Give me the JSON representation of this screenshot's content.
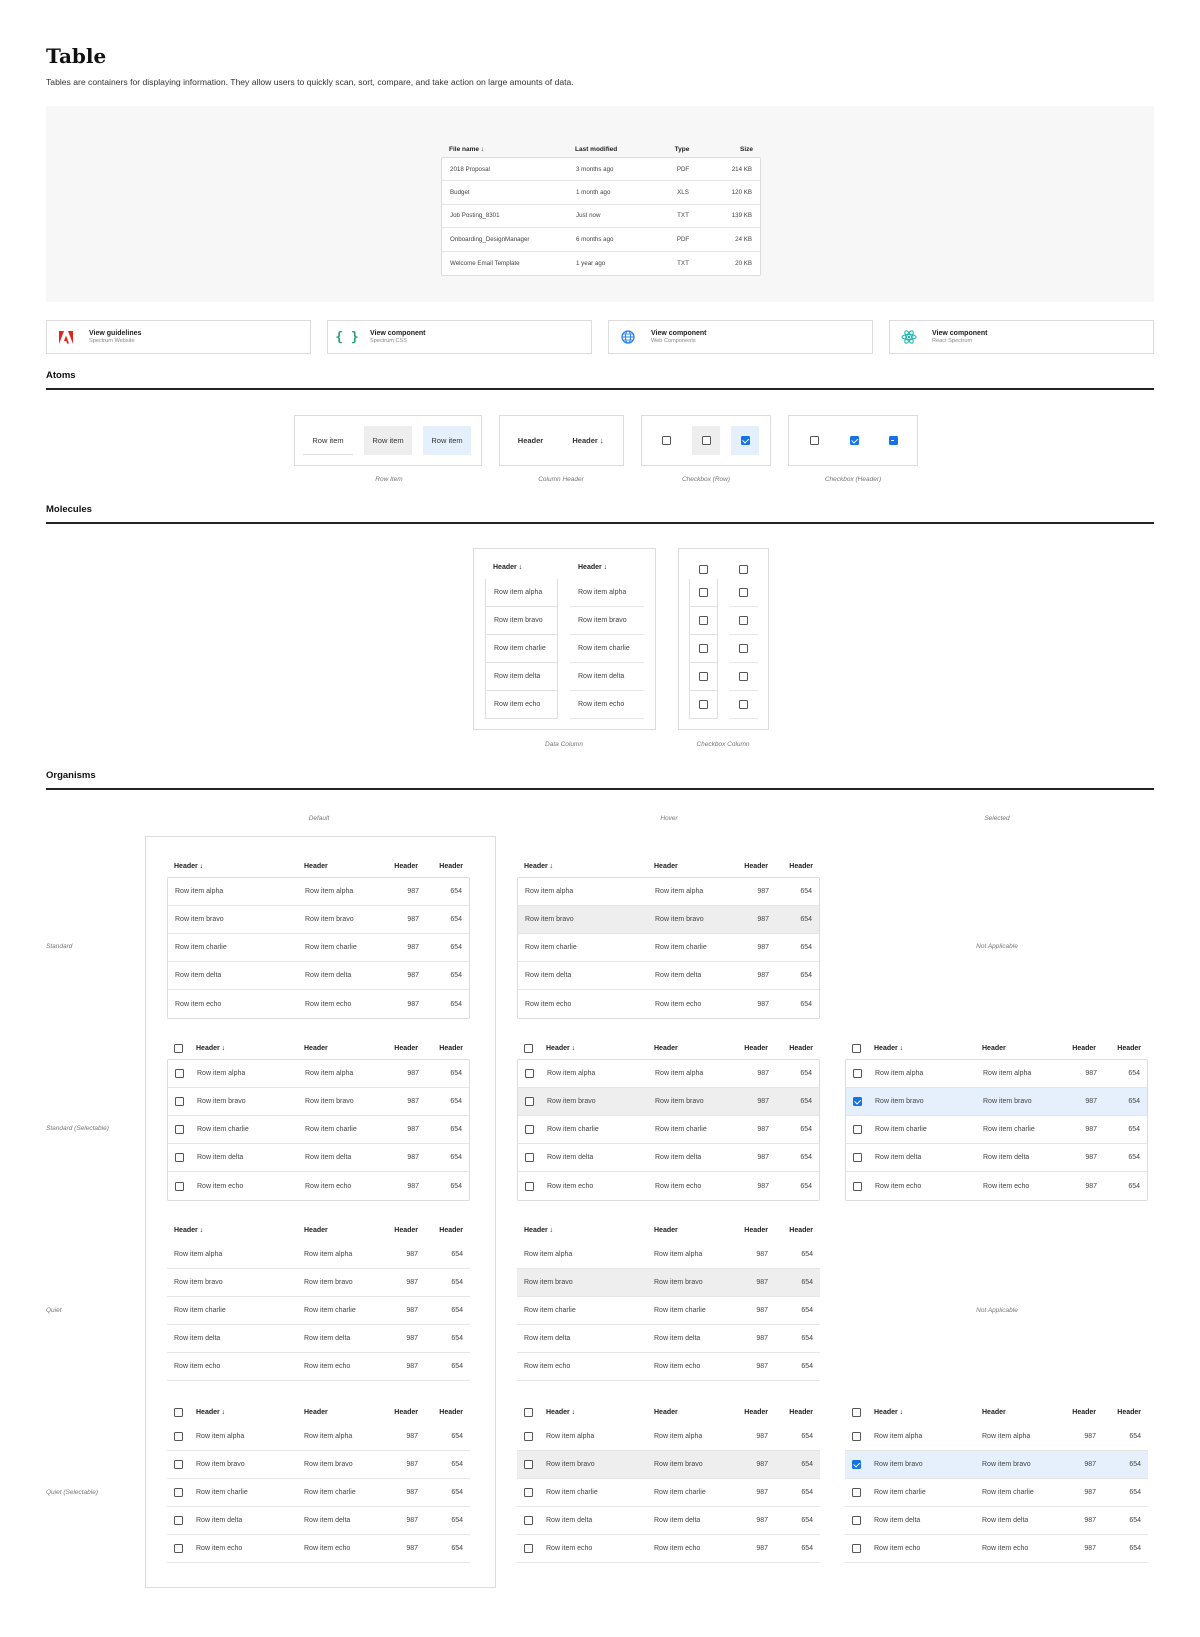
{
  "page": {
    "title": "Table",
    "description": "Tables are containers for displaying information. They allow users to quickly scan, sort, compare, and take action on large amounts of data."
  },
  "hero_table": {
    "headers": [
      "File name ↓",
      "Last modified",
      "Type",
      "Size"
    ],
    "rows": [
      [
        "2018 Proposal",
        "3 months ago",
        "PDF",
        "214 KB"
      ],
      [
        "Budget",
        "1 month ago",
        "XLS",
        "120 KB"
      ],
      [
        "Job Posting_8301",
        "Just now",
        "TXT",
        "139 KB"
      ],
      [
        "Onboarding_DesignManager",
        "6 months ago",
        "PDF",
        "24 KB"
      ],
      [
        "Welcome Email Template",
        "1 year ago",
        "TXT",
        "20 KB"
      ]
    ]
  },
  "cards": [
    {
      "title": "View guidelines",
      "subtitle": "Spectrum Website",
      "icon": "adobe-logo-icon"
    },
    {
      "title": "View component",
      "subtitle": "Spectrum CSS",
      "icon": "curly-braces-icon"
    },
    {
      "title": "View component",
      "subtitle": "Web Components",
      "icon": "globe-icon"
    },
    {
      "title": "View component",
      "subtitle": "React Spectrum",
      "icon": "react-atom-icon"
    }
  ],
  "sections": {
    "atoms": "Atoms",
    "molecules": "Molecules",
    "organisms": "Organisms"
  },
  "atoms": {
    "row_item_label": "Row item",
    "header_label": "Header",
    "header_sorted_label": "Header ↓",
    "captions": [
      "Row Item",
      "Column Header",
      "Checkbox (Row)",
      "Checkbox (Header)"
    ]
  },
  "molecules": {
    "header_sorted": "Header ↓",
    "rows": [
      "Row item alpha",
      "Row item bravo",
      "Row item charlie",
      "Row item delta",
      "Row item echo"
    ],
    "captions": [
      "Data Column",
      "Checkbox Column"
    ]
  },
  "organisms": {
    "columns": [
      "Default",
      "Hover",
      "Selected"
    ],
    "row_labels": [
      "Standard",
      "Standard (Selectable)",
      "Quiet",
      "Quiet (Selectable)"
    ],
    "not_applicable": "Not Applicable",
    "headers": [
      "Header ↓",
      "Header",
      "Header",
      "Header"
    ],
    "rows": [
      [
        "Row item alpha",
        "Row item alpha",
        "987",
        "654"
      ],
      [
        "Row item bravo",
        "Row item bravo",
        "987",
        "654"
      ],
      [
        "Row item charlie",
        "Row item charlie",
        "987",
        "654"
      ],
      [
        "Row item delta",
        "Row item delta",
        "987",
        "654"
      ],
      [
        "Row item echo",
        "Row item echo",
        "987",
        "654"
      ]
    ]
  },
  "colors": {
    "accent": "#1473e6",
    "hover": "#eeeeee",
    "selected": "#e5f0fc",
    "border": "#dcdcdc"
  }
}
